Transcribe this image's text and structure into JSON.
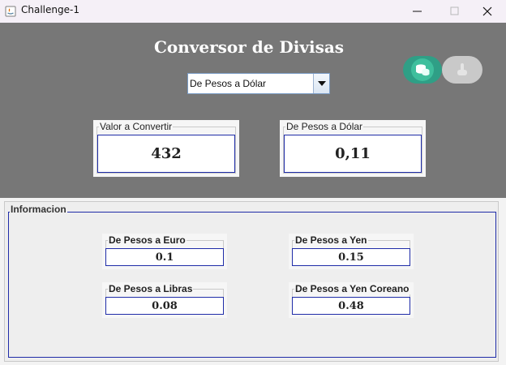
{
  "window": {
    "title": "Challenge-1"
  },
  "header": {
    "title": "Conversor de Divisas"
  },
  "selector": {
    "selected": "De Pesos a Dólar"
  },
  "input_panel": {
    "label": "Valor a Convertir",
    "value": "432"
  },
  "output_panel": {
    "label": "De Pesos a Dólar",
    "value": "0,11"
  },
  "info": {
    "title": "Informacion",
    "items": [
      {
        "label": "De Pesos a Euro",
        "value": "0.1"
      },
      {
        "label": "De Pesos a Yen",
        "value": "0.15"
      },
      {
        "label": "De Pesos a Libras",
        "value": "0.08"
      },
      {
        "label": "De Pesos a Yen Coreano",
        "value": "0.48"
      }
    ]
  },
  "icons": {
    "app": "java-icon",
    "minimize": "minimize-icon",
    "maximize": "maximize-icon",
    "close": "close-icon",
    "dropdown": "chevron-down-icon",
    "toggle_on": "coins-icon",
    "toggle_off": "hand-icon"
  },
  "colors": {
    "accent": "#2f9f86",
    "panel_bg": "#777777",
    "field_border": "#1f2ca8"
  }
}
